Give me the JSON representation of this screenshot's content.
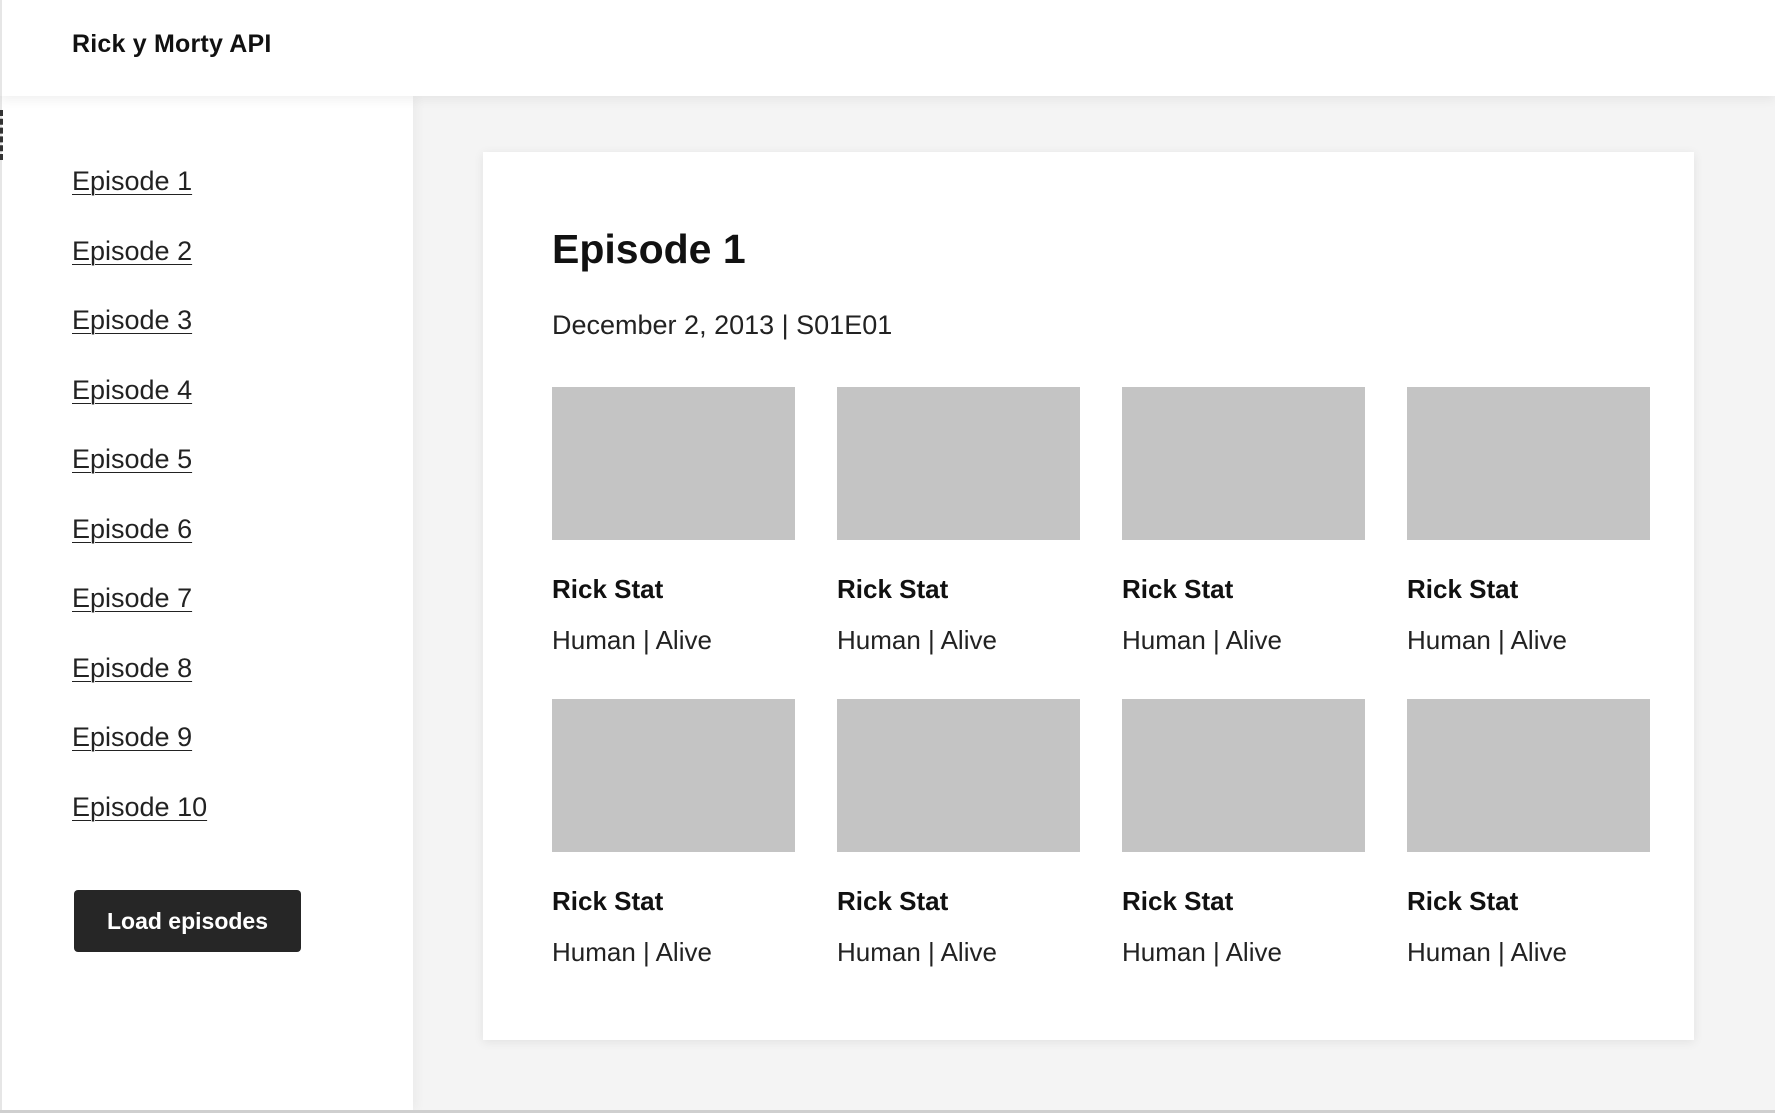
{
  "header": {
    "title": "Rick y Morty API"
  },
  "sidebar": {
    "episodes": [
      {
        "label": "Episode 1"
      },
      {
        "label": "Episode 2"
      },
      {
        "label": "Episode 3"
      },
      {
        "label": "Episode 4"
      },
      {
        "label": "Episode 5"
      },
      {
        "label": "Episode 6"
      },
      {
        "label": "Episode 7"
      },
      {
        "label": "Episode 8"
      },
      {
        "label": "Episode 9"
      },
      {
        "label": "Episode 10"
      }
    ],
    "load_button_label": "Load episodes"
  },
  "episode": {
    "title": "Episode 1",
    "meta": "December 2, 2013 | S01E01",
    "characters": [
      {
        "name": "Rick Stat",
        "meta": "Human | Alive"
      },
      {
        "name": "Rick Stat",
        "meta": "Human | Alive"
      },
      {
        "name": "Rick Stat",
        "meta": "Human | Alive"
      },
      {
        "name": "Rick Stat",
        "meta": "Human | Alive"
      },
      {
        "name": "Rick Stat",
        "meta": "Human | Alive"
      },
      {
        "name": "Rick Stat",
        "meta": "Human | Alive"
      },
      {
        "name": "Rick Stat",
        "meta": "Human | Alive"
      },
      {
        "name": "Rick Stat",
        "meta": "Human | Alive"
      }
    ]
  },
  "colors": {
    "page_background": "#f4f4f4",
    "surface": "#ffffff",
    "image_placeholder": "#c4c4c4",
    "button_background": "#262626",
    "button_text": "#ffffff"
  }
}
